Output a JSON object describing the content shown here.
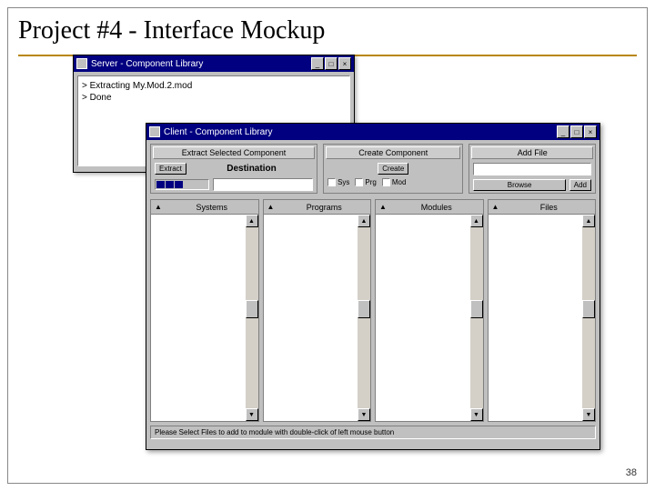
{
  "slide": {
    "title": "Project #4 - Interface Mockup",
    "page_number": "38"
  },
  "server": {
    "title": "Server - Component Library",
    "log": [
      "> Extracting My.Mod.2.mod",
      "> Done"
    ]
  },
  "client": {
    "title": "Client - Component Library",
    "sections": {
      "extract": {
        "label": "Extract Selected Component",
        "button": "Extract"
      },
      "dest": {
        "label": "Destination"
      },
      "create": {
        "label": "Create Component",
        "button": "Create"
      },
      "add": {
        "label": "Add File",
        "browse": "Browse",
        "add_btn": "Add"
      }
    },
    "checks": {
      "sys": "Sys",
      "prg": "Prg",
      "mod": "Mod"
    },
    "columns": [
      "Systems",
      "Programs",
      "Modules",
      "Files"
    ],
    "status": "Please Select Files to add to module with double-click of left mouse button"
  }
}
